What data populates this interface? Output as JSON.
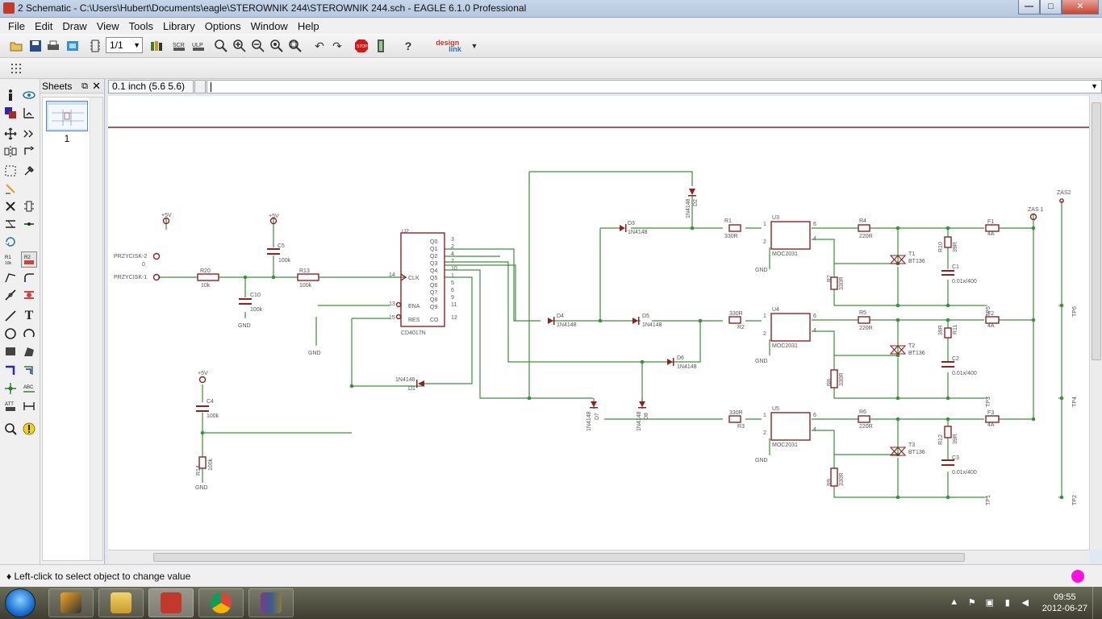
{
  "window": {
    "title": "2 Schematic - C:\\Users\\Hubert\\Documents\\eagle\\STEROWNIK 244\\STEROWNIK 244.sch - EAGLE 6.1.0 Professional",
    "minimize": "—",
    "maximize": "□",
    "close": "✕"
  },
  "menu": [
    "File",
    "Edit",
    "Draw",
    "View",
    "Tools",
    "Library",
    "Options",
    "Window",
    "Help"
  ],
  "toolbar": {
    "sheet_select": "1/1",
    "designlink_top": "design",
    "designlink_bottom": "link"
  },
  "sheets_panel": {
    "title": "Sheets",
    "float": "⧉",
    "close": "✕",
    "items": [
      {
        "number": "1"
      }
    ]
  },
  "command": {
    "coordinates": "0.1 inch (5.6 5.6)",
    "input": ""
  },
  "status": {
    "message": "♦ Left-click to select object to change value",
    "led_color": "#ff10e0"
  },
  "schematic": {
    "parts": {
      "u2": {
        "name": "U2",
        "value": "CD4017N",
        "pins_left": [
          "CLK",
          "ENA",
          "RES"
        ],
        "pins_right": [
          "Q0",
          "Q1",
          "Q2",
          "Q3",
          "Q4",
          "Q5",
          "Q6",
          "Q7",
          "Q8",
          "Q9",
          "CO"
        ],
        "pin_nums_right": [
          "3",
          "2",
          "4",
          "7",
          "10",
          "1",
          "5",
          "6",
          "9",
          "11",
          "12"
        ],
        "pin_nums_left": [
          "14",
          "13",
          "15"
        ]
      },
      "r20": {
        "name": "R20",
        "value": "10k"
      },
      "r13": {
        "name": "R13",
        "value": "100k"
      },
      "r14": {
        "name": "R14",
        "value": "100k"
      },
      "c10": {
        "name": "C10",
        "value": "100k"
      },
      "c5": {
        "name": "C5",
        "value": "100k"
      },
      "c4": {
        "name": "C4",
        "value": "100k"
      },
      "d1": {
        "name": "D1",
        "value": "1N4148"
      },
      "d2": {
        "name": "D2",
        "value": "1N4148"
      },
      "d3": {
        "name": "D3",
        "value": "1N4148"
      },
      "d4": {
        "name": "D4",
        "value": "1N4148"
      },
      "d5": {
        "name": "D5",
        "value": "1N4148"
      },
      "d6": {
        "name": "D6",
        "value": "1N4148"
      },
      "d7": {
        "name": "D7",
        "value": "1N4148"
      },
      "d8": {
        "name": "D8",
        "value": "1N4148"
      },
      "r1": {
        "name": "R1",
        "value": "330R"
      },
      "r2": {
        "name": "R2",
        "value": "330R"
      },
      "r3": {
        "name": "R3",
        "value": "330R"
      },
      "u3": {
        "name": "U3",
        "value": "MOC2031"
      },
      "u4": {
        "name": "U4",
        "value": "MOC2031"
      },
      "u5": {
        "name": "U5",
        "value": "MOC2031"
      },
      "r4": {
        "name": "R4",
        "value": "220R"
      },
      "r5": {
        "name": "R5",
        "value": "220R"
      },
      "r6": {
        "name": "R6",
        "value": "220R"
      },
      "r7": {
        "name": "R7",
        "value": "330R"
      },
      "r8": {
        "name": "R8",
        "value": "330R"
      },
      "r9": {
        "name": "R9",
        "value": "330R"
      },
      "t1": {
        "name": "T1",
        "value": "BT136"
      },
      "t2": {
        "name": "T2",
        "value": "BT136"
      },
      "t3": {
        "name": "T3",
        "value": "BT136"
      },
      "r10": {
        "name": "R10",
        "value": "39R"
      },
      "r11": {
        "name": "R11",
        "value": "39R"
      },
      "r12": {
        "name": "R12",
        "value": "39R"
      },
      "c1": {
        "name": "C1",
        "value": "0.01x/400"
      },
      "c2": {
        "name": "C2",
        "value": "0.01x/400"
      },
      "c3": {
        "name": "C3",
        "value": "0.01x/400"
      },
      "f1": {
        "name": "F1",
        "value": "4A"
      },
      "f2": {
        "name": "F2",
        "value": "4A"
      },
      "f3": {
        "name": "F3",
        "value": "4A"
      }
    },
    "labels": {
      "sv": "+5V",
      "gnd": "GND",
      "przycisk2": "PRZYCISK-2",
      "przycisk1": "PRZYCISK-1",
      "przycisk2_num": "0",
      "zas1": "ZAS 1",
      "zas2": "ZAS2",
      "tp1": "TP1",
      "tp2": "TP2",
      "tp3": "TP3",
      "tp4": "TP4",
      "tp5": "TP5",
      "tp6": "TP6",
      "moc_pin1": "1",
      "moc_pin2": "2",
      "moc_pin4": "4",
      "moc_pin6": "6"
    }
  },
  "taskbar": {
    "time": "09:55",
    "date": "2012-06-27"
  },
  "colors": {
    "wire": "#3c8f3c",
    "part": "#8b2323",
    "frame": "#8b2323",
    "text": "#555555"
  }
}
